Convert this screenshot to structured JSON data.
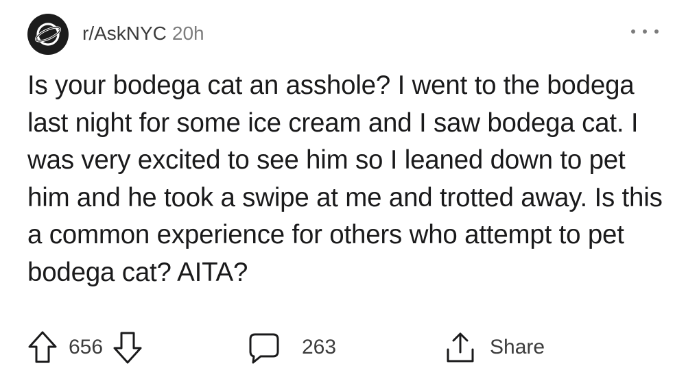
{
  "post": {
    "subreddit": "r/AskNYC",
    "time_ago": "20h",
    "title": "Is your bodega cat an asshole? I went to the bodega last night for some ice cream and I saw bodega cat. I was very excited to see him so I leaned down to pet him and he took a swipe at me and trotted away. Is this a common experience for others who attempt to pet bodega cat? AITA?",
    "votes": "656",
    "comments": "263",
    "share_label": "Share"
  },
  "icons": {
    "avatar": "planet-icon",
    "more": "more-options-icon",
    "upvote": "upvote-arrow-icon",
    "downvote": "downvote-arrow-icon",
    "comment": "comment-bubble-icon",
    "share": "share-icon"
  },
  "colors": {
    "text": "#1a1a1b",
    "meta": "#7c7c7c",
    "avatar_bg": "#1c1c1c"
  }
}
